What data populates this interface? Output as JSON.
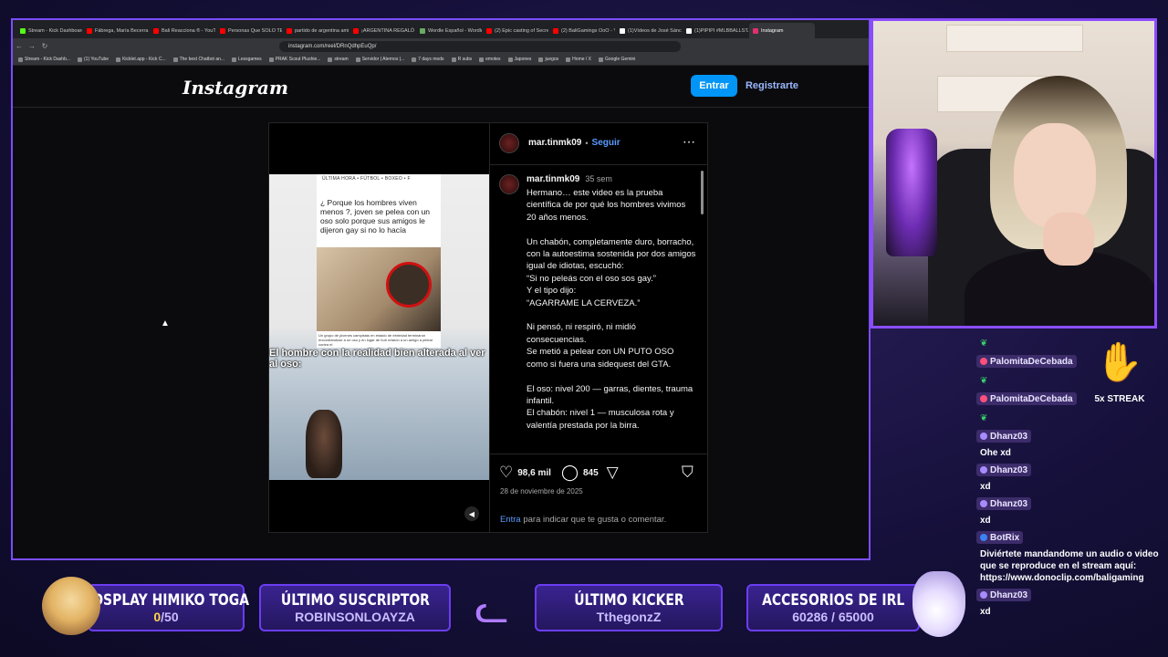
{
  "browser": {
    "tabs": [
      {
        "label": "Stream - Kick Dashboard",
        "color": "#53fc18"
      },
      {
        "label": "Fábrega, María Becerra - M",
        "color": "#ff0000"
      },
      {
        "label": "Bali Reacciona ® - YouTu",
        "color": "#ff0000"
      },
      {
        "label": "Personas Que SOLO TENÍ",
        "color": "#ff0000"
      },
      {
        "label": "partido de argentina amig",
        "color": "#ff0000"
      },
      {
        "label": "¡ARGENTINA REGALÓ LA",
        "color": "#ff0000"
      },
      {
        "label": "Wordle Español - Wordle",
        "color": "#6aaa64"
      },
      {
        "label": "(2) Epic casting of Secret",
        "color": "#ff0000"
      },
      {
        "label": "(2) BaliGamings OoO - YouTu",
        "color": "#ff0000"
      },
      {
        "label": "(1)Vídeos de José Sánchez",
        "color": "#ffffff"
      },
      {
        "label": "(1)PIPIPI #MLBBALLSTAR",
        "color": "#ffffff"
      },
      {
        "label": "Instagram",
        "color": "#e1306c",
        "active": true
      }
    ],
    "url": "instagram.com/reel/DRnQdhpEuQp/",
    "bookmarks": [
      "Stream - Kick Dashb...",
      "(1) YouTube",
      "Kicklet.app - Kick C...",
      "The best Chatbot an...",
      "Lessgames",
      "PRAK Scout Plushie...",
      "stream",
      "Servidor | Aternos |...",
      "7 days mods",
      "R subs",
      "emotes",
      "Japones",
      "juegos",
      "Home / X",
      "Google Gemini"
    ]
  },
  "instagram": {
    "logo": "Instagram",
    "login_label": "Entrar",
    "signup_label": "Registrarte",
    "post": {
      "username": "mar.tinmk09",
      "separator": "•",
      "follow_label": "Seguir",
      "more_icon": "more-horizontal-icon",
      "caption_time": "35 sem",
      "caption": "Hermano… este video es la prueba científica de por qué los hombres vivimos 20 años menos.\n\nUn chabón, completamente duro, borracho, con la autoestima sostenida por dos amigos igual de idiotas, escuchó:\n“Si no peleás con el oso sos gay.”\nY el tipo dijo:\n“AGARRAME LA CERVEZA.”\n\nNi pensó, ni respiró, ni midió consecuencias.\nSe metió a pelear con UN PUTO OSO como si fuera una sidequest del GTA.\n\nEl oso: nivel 200 — garras, dientes, trauma infantil.\nEl chabón: nivel 1 — musculosa rota y valentía prestada por la birra.",
      "likes": "98,6 mil",
      "comments": "845",
      "date": "28 de noviembre de 2025",
      "login_prompt_link": "Entra",
      "login_prompt_rest": " para indicar que te gusta o comentar.",
      "video": {
        "news_nav": "ÚLTIMA HORA   •   FÚTBOL   •   BOXEO   •   F",
        "news_title": "¿ Porque los hombres viven menos ?, joven se pelea con un oso solo porque sus amigos le dijeron gay si no lo hacía",
        "news_caption": "Un grupo de jóvenes campistas en estado de ebriedad terminaron encontrándose a un oso y en lugar de huir retaron a un amigo a pelear contra el",
        "overlay_text": "El hombre con la realidad bien alterada al ver al oso:"
      }
    }
  },
  "chat": {
    "streak_label": "5x STREAK",
    "messages": [
      {
        "user": "",
        "emote": true
      },
      {
        "user": "PalomitaDeCebada",
        "badge": "#ff4f7b"
      },
      {
        "user": "",
        "emote": true
      },
      {
        "user": "PalomitaDeCebada",
        "badge": "#ff4f7b"
      },
      {
        "user": "",
        "emote": true
      },
      {
        "user": "Dhanz03",
        "badge": "#a78bff",
        "text": "Ohe xd"
      },
      {
        "user": "Dhanz03",
        "badge": "#a78bff",
        "text": "xd"
      },
      {
        "user": "Dhanz03",
        "badge": "#a78bff",
        "text": "xd"
      },
      {
        "user": "BotRix",
        "badge": "#3b82f6",
        "text": "Diviértete mandandome un audio o video que se reproduce en el stream aquí: https://www.donoclip.com/baligaming"
      },
      {
        "user": "Dhanz03",
        "badge": "#a78bff",
        "text": "xd"
      }
    ]
  },
  "overlay": {
    "cosplay": {
      "title": "COSPLAY HIMIKO TOGA",
      "current": "0",
      "goal": "/50"
    },
    "last_sub": {
      "title": "ÚLTIMO SUSCRIPTOR",
      "value": "ROBINSONLOAYZA"
    },
    "last_kicker": {
      "title": "ÚLTIMO KICKER",
      "value": "TthegonzZ"
    },
    "irl": {
      "title": "ACCESORIOS DE IRL",
      "value": "60286 / 65000"
    }
  }
}
